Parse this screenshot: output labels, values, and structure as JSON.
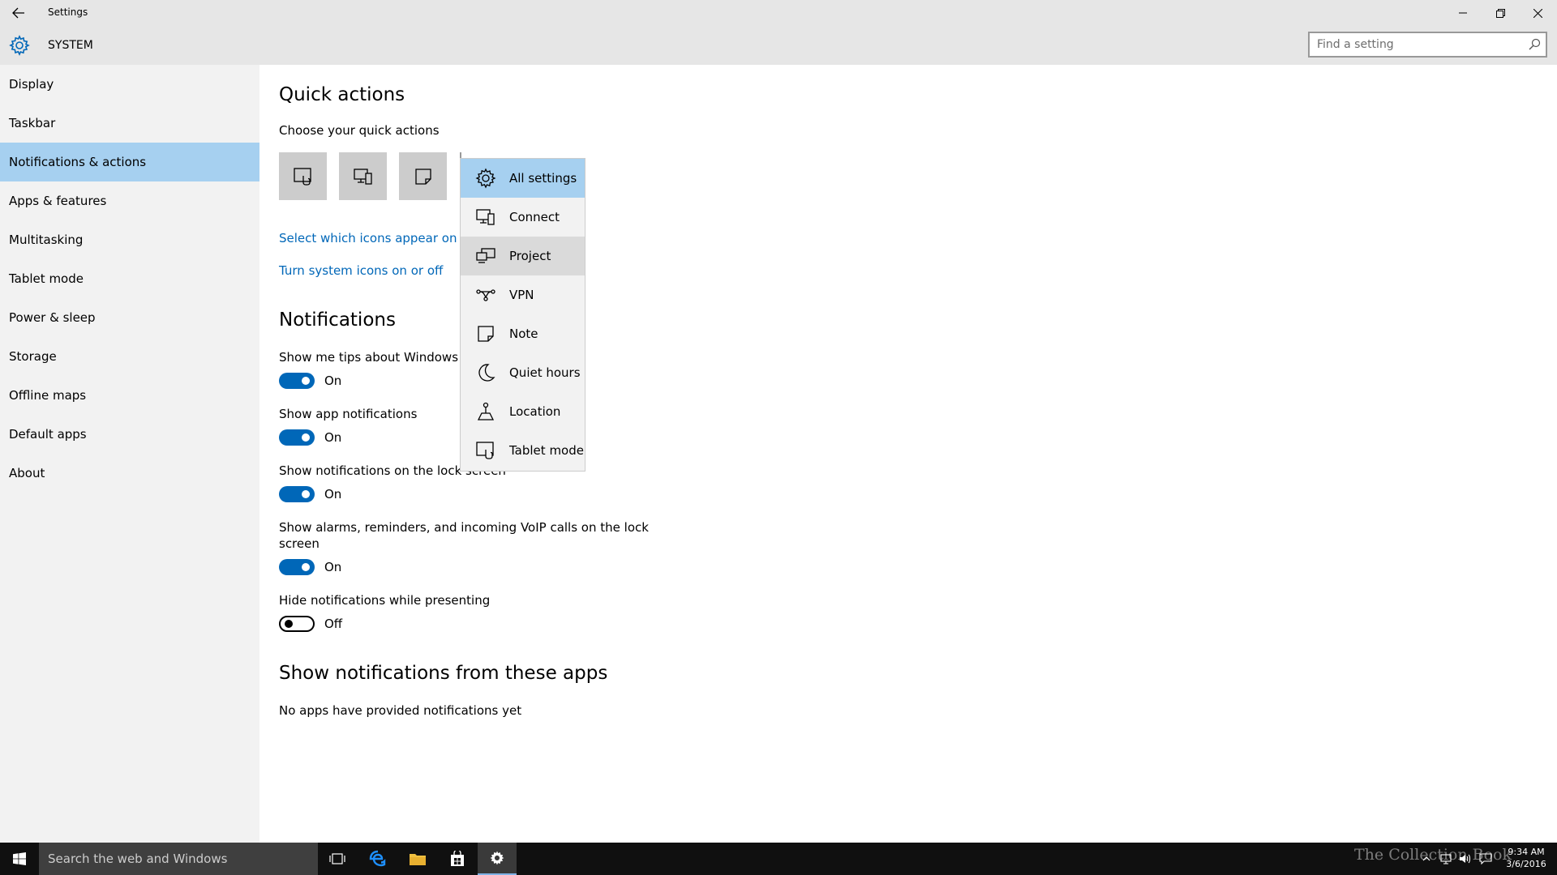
{
  "window": {
    "title": "Settings"
  },
  "header": {
    "title": "SYSTEM",
    "search_placeholder": "Find a setting"
  },
  "sidebar": {
    "items": [
      {
        "label": "Display"
      },
      {
        "label": "Taskbar"
      },
      {
        "label": "Notifications & actions",
        "active": true
      },
      {
        "label": "Apps & features"
      },
      {
        "label": "Multitasking"
      },
      {
        "label": "Tablet mode"
      },
      {
        "label": "Power & sleep"
      },
      {
        "label": "Storage"
      },
      {
        "label": "Offline maps"
      },
      {
        "label": "Default apps"
      },
      {
        "label": "About"
      }
    ]
  },
  "quick_actions": {
    "heading": "Quick actions",
    "subheading": "Choose your quick actions",
    "tiles": [
      {
        "icon": "tablet-mode-icon"
      },
      {
        "icon": "connect-icon"
      },
      {
        "icon": "note-icon"
      }
    ],
    "link_icons": "Select which icons appear on the",
    "link_system": "Turn system icons on or off"
  },
  "menu": {
    "items": [
      {
        "label": "All settings",
        "icon": "gear-icon",
        "state": "selected"
      },
      {
        "label": "Connect",
        "icon": "connect-icon"
      },
      {
        "label": "Project",
        "icon": "project-icon",
        "state": "hover"
      },
      {
        "label": "VPN",
        "icon": "vpn-icon"
      },
      {
        "label": "Note",
        "icon": "note-icon"
      },
      {
        "label": "Quiet hours",
        "icon": "moon-icon"
      },
      {
        "label": "Location",
        "icon": "location-icon"
      },
      {
        "label": "Tablet mode",
        "icon": "tablet-mode-icon"
      }
    ]
  },
  "notifications": {
    "heading": "Notifications",
    "settings": [
      {
        "label": "Show me tips about Windows",
        "state": "On",
        "on": true
      },
      {
        "label": "Show app notifications",
        "state": "On",
        "on": true
      },
      {
        "label": "Show notifications on the lock screen",
        "state": "On",
        "on": true
      },
      {
        "label_line1": "Show alarms, reminders, and incoming VoIP calls on the lock",
        "label_line2": "screen",
        "state": "On",
        "on": true
      },
      {
        "label": "Hide notifications while presenting",
        "state": "Off",
        "on": false
      }
    ]
  },
  "apps_section": {
    "heading": "Show notifications from these apps",
    "empty_text": "No apps have provided notifications yet"
  },
  "taskbar": {
    "search_placeholder": "Search the web and Windows",
    "watermark": "The Collection Book",
    "time": "9:34 AM",
    "date": "3/6/2016"
  },
  "colors": {
    "accent": "#0067b8",
    "selection": "#a6d0f0",
    "chrome": "#e6e6e6",
    "sidebar": "#f2f2f2",
    "taskbar": "#101010"
  }
}
